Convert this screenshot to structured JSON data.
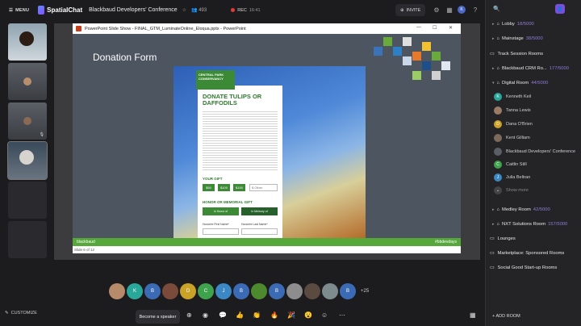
{
  "topbar": {
    "menu_label": "MENU",
    "app_name": "SpatialChat",
    "conference": "Blackbaud Developers' Conference",
    "people_count": "493",
    "rec_label": "REC",
    "rec_time": "16:41",
    "invite_label": "INVITE",
    "user_initial": "K"
  },
  "slide": {
    "window_title": "PowerPoint Slide Show - FINAL_GTM_LuminateOnline_Eloqua.pptx - PowerPoint",
    "title": "Donation Form",
    "org_badge": "CENTRAL PARK CONSERVANCY",
    "card_title": "DONATE TULIPS OR DAFFODILS",
    "gift_label": "YOUR GIFT",
    "gift_options": [
      "$50",
      "$100",
      "$150"
    ],
    "gift_other": "$ Other",
    "honor_label": "HONOR OR MEMORIAL GIFT",
    "honor_options": [
      "In Honor of",
      "In Memory of"
    ],
    "first_name_label": "Honoree First Name*",
    "last_name_label": "Honoree Last Name*",
    "footer_brand": "blackbaud",
    "footer_right": "#bbdevdays",
    "status": "Slide 6 of 12"
  },
  "participants": {
    "avatars": [
      "",
      "K",
      "B",
      "",
      "D",
      "C",
      "J",
      "B",
      "",
      "B",
      "",
      "",
      "",
      "B"
    ],
    "more": "+25"
  },
  "bottombar": {
    "customize_label": "CUSTOMIZE",
    "speaker_label": "Become a speaker"
  },
  "sidebar": {
    "rooms_top": [
      {
        "name": "Lobby",
        "count": "18/5000"
      },
      {
        "name": "Mainstage",
        "count": "38/5000"
      }
    ],
    "track_section": "Track Session Rooms",
    "crm_room": {
      "name": "Blackbaud CRM Ro...",
      "count": "177/5000"
    },
    "digital_room": {
      "name": "Digital Room",
      "count": "44/5000"
    },
    "members": [
      {
        "initial": "K",
        "name": "Kenneth Keil",
        "color": "#2aa79b"
      },
      {
        "initial": "",
        "name": "Tanna Lewis",
        "color": "#9a7b66"
      },
      {
        "initial": "D",
        "name": "Dana O'Brien",
        "color": "#c9a227"
      },
      {
        "initial": "",
        "name": "Kent Gilliam",
        "color": "#7d6a5c"
      },
      {
        "initial": "",
        "name": "Blackbaud Developers' Conference",
        "color": "#5a5f66"
      },
      {
        "initial": "C",
        "name": "Caitlin Still",
        "color": "#3fa34d"
      },
      {
        "initial": "J",
        "name": "Julia Beltran",
        "color": "#3b88c4"
      }
    ],
    "show_more": "Show more",
    "medley_room": {
      "name": "Medley Room",
      "count": "42/5000"
    },
    "nxt_room": {
      "name": "NXT Solutions Room",
      "count": "157/5000"
    },
    "lounges": "Lounges",
    "marketplace": "Marketplace: Sponsored Rooms",
    "social_good": "Social Good Start-up Rooms",
    "add_room": "ADD ROOM"
  },
  "colors": {
    "accent": "#8f7bd9",
    "brand_green": "#56a83a",
    "rec": "#e23b3b"
  }
}
